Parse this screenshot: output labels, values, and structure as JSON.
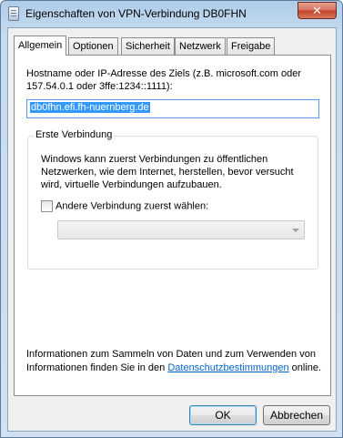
{
  "window": {
    "title": "Eigenschaften von VPN-Verbindung DB0FHN",
    "close_label": "✕"
  },
  "tabs": [
    {
      "label": "Allgemein",
      "active": true
    },
    {
      "label": "Optionen",
      "active": false
    },
    {
      "label": "Sicherheit",
      "active": false
    },
    {
      "label": "Netzwerk",
      "active": false
    },
    {
      "label": "Freigabe",
      "active": false
    }
  ],
  "general": {
    "host_label": "Hostname oder IP-Adresse des Ziels (z.B. microsoft.com oder 157.54.0.1 oder 3ffe:1234::1111):",
    "host_value": "db0fhn.efi.fh-nuernberg.de",
    "first_connection": {
      "legend": "Erste Verbindung",
      "description": "Windows kann zuerst Verbindungen zu öffentlichen Netzwerken, wie dem Internet, herstellen, bevor versucht wird, virtuelle Verbindungen aufzubauen.",
      "checkbox_label": "Andere Verbindung zuerst wählen:",
      "checkbox_checked": false,
      "dropdown_value": ""
    },
    "privacy": {
      "text_before": "Informationen zum Sammeln von Daten und zum Verwenden von Informationen finden Sie in den ",
      "link_text": "Datenschutzbestimmungen",
      "text_after": " online."
    }
  },
  "buttons": {
    "ok": "OK",
    "cancel": "Abbrechen"
  },
  "colors": {
    "titlebar": "#c6dcf0",
    "close_button": "#c4432a",
    "link": "#0066cc",
    "selection": "#3399ff"
  }
}
